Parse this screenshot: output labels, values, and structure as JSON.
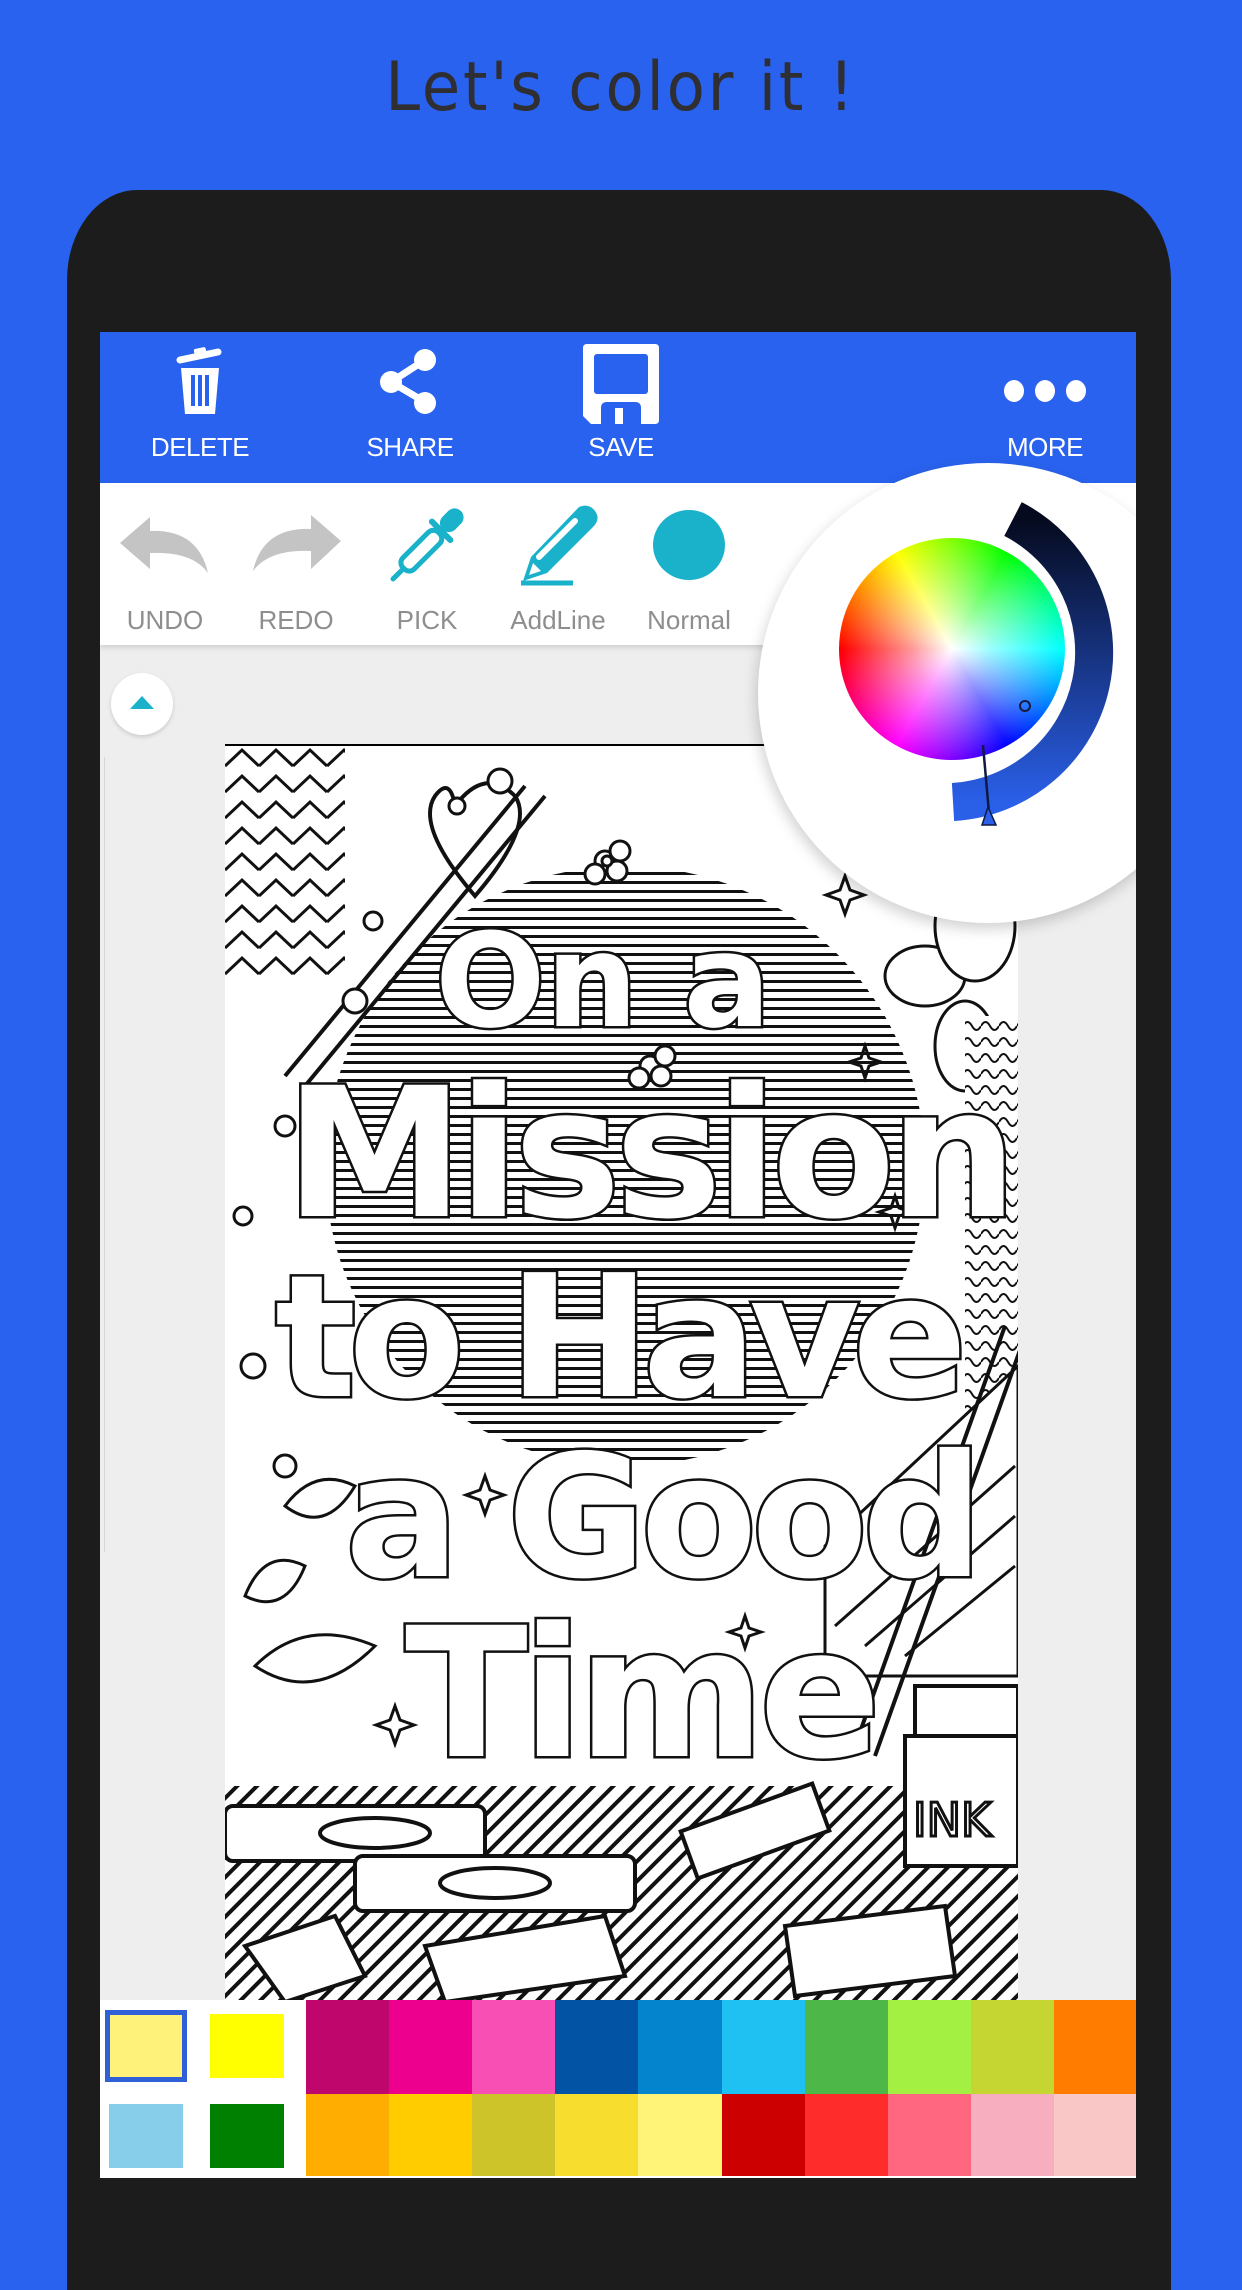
{
  "headline": "Let's color it !",
  "action_bar": {
    "color": "#2962ee",
    "items": [
      {
        "label": "DELETE",
        "icon": "trash-icon"
      },
      {
        "label": "SHARE",
        "icon": "share-icon"
      },
      {
        "label": "SAVE",
        "icon": "floppy-disk-icon"
      },
      {
        "label": "MORE",
        "icon": "more-dots-icon"
      }
    ]
  },
  "tool_bar": {
    "accent": "#1ab2cb",
    "items": [
      {
        "label": "UNDO",
        "icon": "undo-arrow-icon",
        "enabled": false
      },
      {
        "label": "REDO",
        "icon": "redo-arrow-icon",
        "enabled": false
      },
      {
        "label": "PICK",
        "icon": "eyedropper-icon",
        "enabled": true
      },
      {
        "label": "AddLine",
        "icon": "pencil-line-icon",
        "enabled": true
      },
      {
        "label": "Normal",
        "icon": "brush-circle-icon",
        "enabled": true
      }
    ]
  },
  "canvas": {
    "expand_icon": "chevron-up-icon",
    "page_text": [
      "On a",
      "Mission",
      "to Have",
      "a Good",
      "Time"
    ],
    "ink_label": "INK"
  },
  "color_picker": {
    "selected_color": "#2a5fe8",
    "value_ring_from": "#050a1e",
    "value_ring_to": "#2a5fe8"
  },
  "palette": {
    "recent": [
      {
        "color": "#fff27a",
        "selected": true
      },
      {
        "color": "#ffff00",
        "selected": false
      },
      {
        "color": "#87ceeb",
        "selected": false
      },
      {
        "color": "#008000",
        "selected": false
      }
    ],
    "row1": [
      "#be066d",
      "#ee008f",
      "#f74fb4",
      "#0353a4",
      "#0384cc",
      "#1ec1f1",
      "#4db748",
      "#a3f042",
      "#c5d633",
      "#ff7c00"
    ],
    "row2": [
      "#ffad00",
      "#ffcc00",
      "#cdc42a",
      "#f7dd2d",
      "#fff378",
      "#cc0000",
      "#ff2c2c",
      "#ff6680",
      "#f7aebf",
      "#f9c8c6"
    ]
  }
}
